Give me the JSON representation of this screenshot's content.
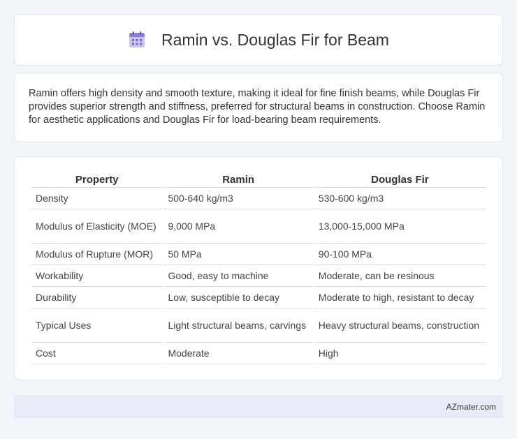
{
  "header": {
    "icon": "calendar-icon",
    "title": "Ramin vs. Douglas Fir for Beam"
  },
  "summary": {
    "text": "Ramin offers high density and smooth texture, making it ideal for fine finish beams, while Douglas Fir provides superior strength and stiffness, preferred for structural beams in construction. Choose Ramin for aesthetic applications and Douglas Fir for load-bearing beam requirements."
  },
  "table": {
    "headers": [
      "Property",
      "Ramin",
      "Douglas Fir"
    ],
    "rows": [
      [
        "Density",
        "500-640 kg/m3",
        "530-600 kg/m3"
      ],
      [
        "Modulus of Elasticity (MOE)",
        "9,000 MPa",
        "13,000-15,000 MPa"
      ],
      [
        "Modulus of Rupture (MOR)",
        "50 MPa",
        "90-100 MPa"
      ],
      [
        "Workability",
        "Good, easy to machine",
        "Moderate, can be resinous"
      ],
      [
        "Durability",
        "Low, susceptible to decay",
        "Moderate to high, resistant to decay"
      ],
      [
        "Typical Uses",
        "Light structural beams, carvings",
        "Heavy structural beams, construction"
      ],
      [
        "Cost",
        "Moderate",
        "High"
      ]
    ]
  },
  "footer": {
    "text": "AZmater.com"
  },
  "colors": {
    "background": "#f1f4f9",
    "card": "#ffffff",
    "footer": "#e6ebf5",
    "icon_accent": "#8a7fd4"
  }
}
